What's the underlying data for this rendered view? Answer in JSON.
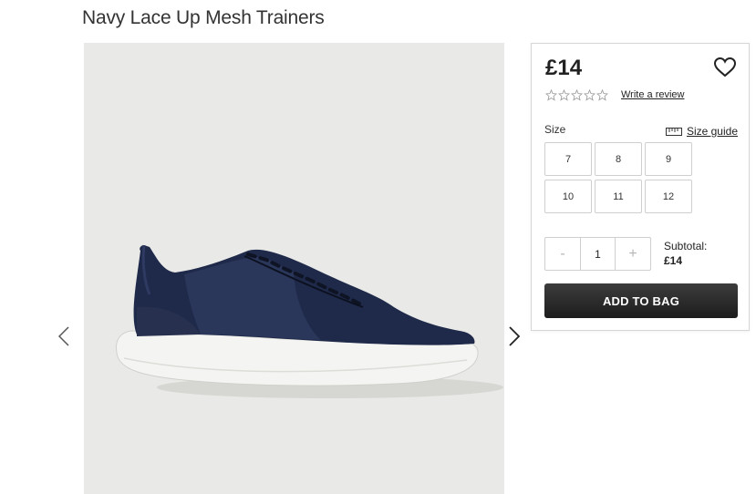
{
  "product": {
    "title": "Navy Lace Up Mesh Trainers",
    "image_alt": "navy mesh trainer with white sole",
    "price": "£14",
    "rating_stars": 0,
    "rating_max": 5,
    "review_link": "Write a review"
  },
  "icons": {
    "wishlist": "heart-outline-icon",
    "size_guide": "ruler-icon",
    "prev": "chevron-left-icon",
    "next": "chevron-right-icon",
    "star": "star-outline-icon"
  },
  "size_section": {
    "label": "Size",
    "guide_label": "Size guide",
    "sizes": [
      "7",
      "8",
      "9",
      "10",
      "11",
      "12"
    ]
  },
  "quantity": {
    "minus": "-",
    "value": "1",
    "plus": "+"
  },
  "subtotal": {
    "label": "Subtotal:",
    "amount": "£14"
  },
  "add_to_bag": {
    "label": "ADD TO BAG"
  },
  "colors": {
    "button_bg": "#222222",
    "image_bg": "#e9e9e7",
    "shoe": "#1f2a4a"
  }
}
